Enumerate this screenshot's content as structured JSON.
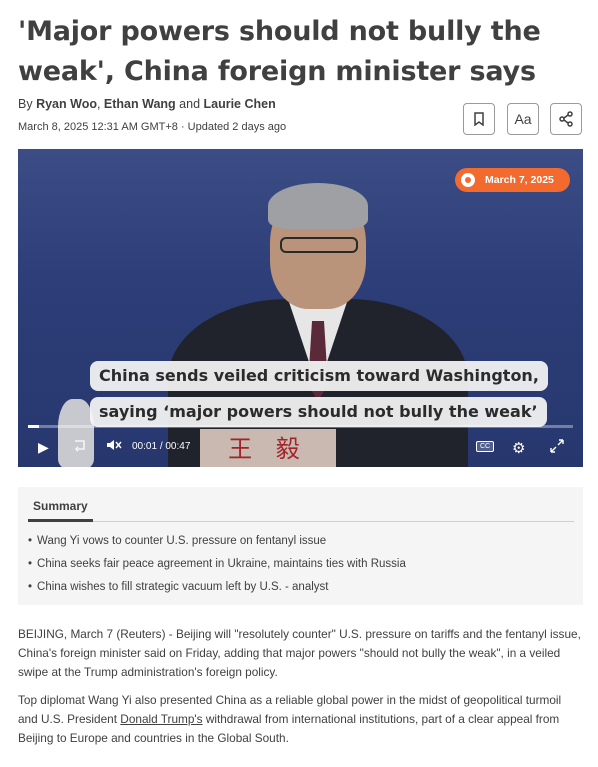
{
  "article": {
    "headline": "'Major powers should not bully the weak', China foreign minister says",
    "byline_prefix": "By",
    "authors": [
      "Ryan Woo",
      "Ethan Wang",
      "Laurie Chen"
    ],
    "author_separator": ", ",
    "author_and": " and ",
    "dateline": "March 8, 2025 12:31 AM GMT+8 · Updated 2 days ago"
  },
  "toolbar": {
    "text_size_label": "Aa",
    "icons": {
      "bookmark": "bookmark-icon",
      "share": "share-icon"
    }
  },
  "video": {
    "date_badge": "March 7, 2025",
    "caption_line_1": "China sends veiled criticism toward Washington,",
    "caption_line_2": "saying ‘major powers should not bully the weak’",
    "nameplate": "王 毅",
    "time_current": "00:01",
    "time_separator": "/",
    "time_total": "00:47",
    "progress_fraction": 0.02,
    "cc_label": "CC"
  },
  "summary": {
    "title": "Summary",
    "items": [
      "Wang Yi vows to counter U.S. pressure on fentanyl issue",
      "China seeks fair peace agreement in Ukraine, maintains ties with Russia",
      "China wishes to fill strategic vacuum left by U.S. - analyst"
    ]
  },
  "body": {
    "paragraph_1": "BEIJING, March 7 (Reuters) - Beijing will \"resolutely counter\" U.S. pressure on tariffs and the fentanyl issue, China's foreign minister said on Friday, adding that major powers \"should not bully the weak\", in a veiled swipe at the Trump administration's foreign policy.",
    "paragraph_2_before_link": "Top diplomat Wang Yi also presented China as a reliable global power in the midst of geopolitical turmoil and U.S. President ",
    "paragraph_2_link": "Donald Trump's",
    "paragraph_2_after_link": " withdrawal from international institutions, part of a clear appeal from Beijing to Europe and countries in the Global South."
  }
}
